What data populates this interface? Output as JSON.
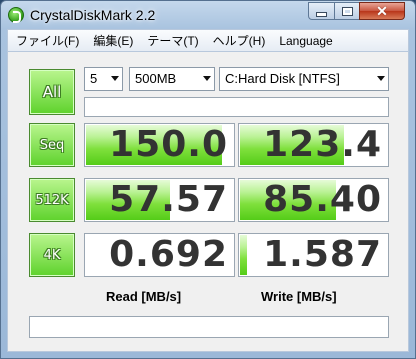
{
  "window": {
    "title": "CrystalDiskMark 2.2"
  },
  "menu": [
    "ファイル(F)",
    "編集(E)",
    "テーマ(T)",
    "ヘルプ(H)",
    "Language"
  ],
  "controls": {
    "all_label": "All",
    "test_count": "5",
    "test_size": "500MB",
    "drive": "C:Hard Disk [NTFS]"
  },
  "rows": [
    {
      "label": "Seq",
      "read": "150.0",
      "write": "123.4",
      "read_fill": 0.94,
      "write_fill": 0.72
    },
    {
      "label": "512K",
      "read": "57.57",
      "write": "85.40",
      "read_fill": 0.58,
      "write_fill": 0.66
    },
    {
      "label": "4K",
      "read": "0.692",
      "write": "1.587",
      "read_fill": 0.0,
      "write_fill": 0.05
    }
  ],
  "columns": {
    "read": "Read [MB/s]",
    "write": "Write [MB/s]"
  },
  "colors": {
    "accent_green": "#5ed22c",
    "close_red": "#c8553e"
  }
}
